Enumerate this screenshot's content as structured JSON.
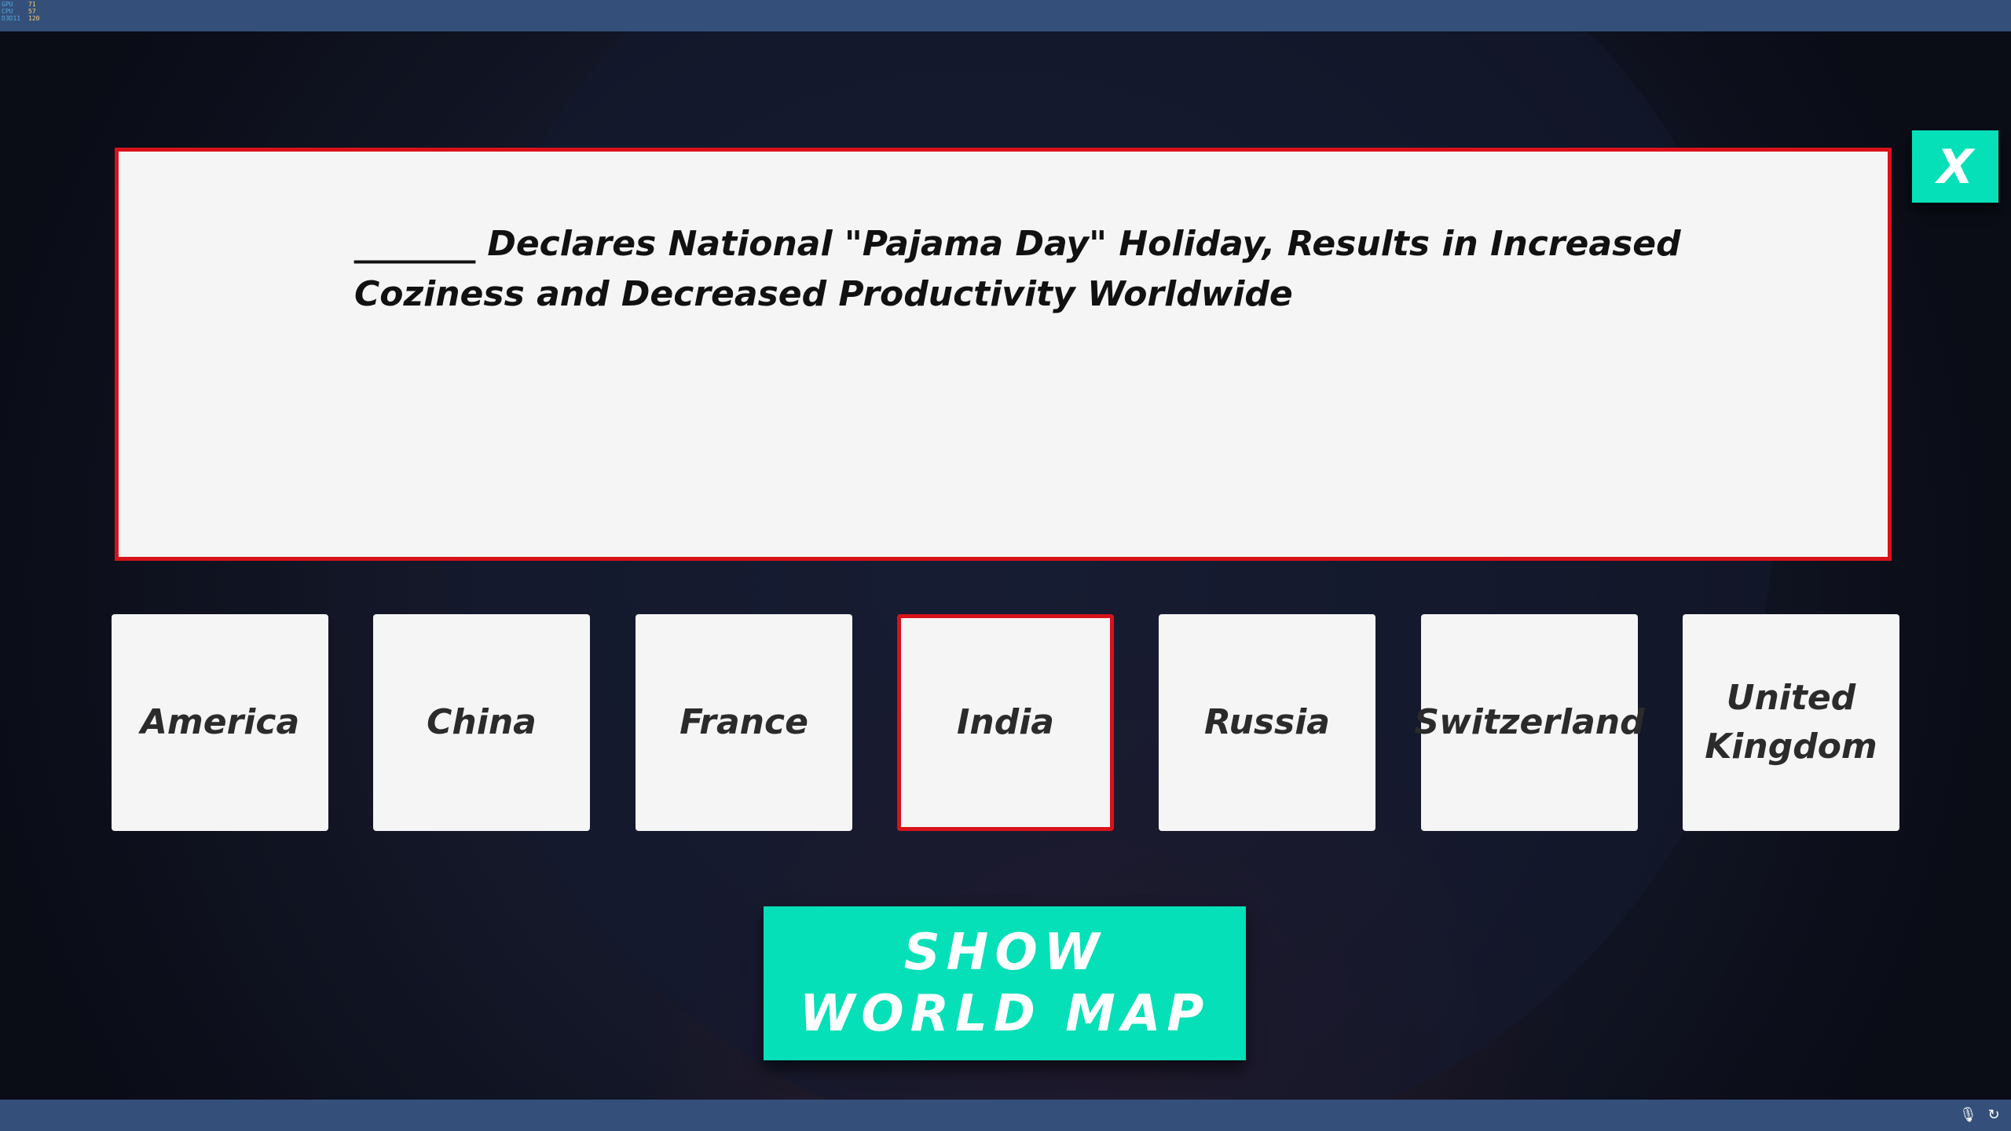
{
  "overlay": {
    "perf": [
      {
        "label": "GPU",
        "value": "71"
      },
      {
        "label": "CPU",
        "value": "57"
      },
      {
        "label": "D3D11",
        "value": "120"
      }
    ]
  },
  "question": {
    "headline": "_______ Declares National \"Pajama Day\" Holiday, Results in Increased Coziness and Decreased Productivity Worldwide"
  },
  "close_label": "X",
  "options": [
    {
      "label": "America",
      "selected": false
    },
    {
      "label": "China",
      "selected": false
    },
    {
      "label": "France",
      "selected": false
    },
    {
      "label": "India",
      "selected": true
    },
    {
      "label": "Russia",
      "selected": false
    },
    {
      "label": "Switzerland",
      "selected": false
    },
    {
      "label": "United Kingdom",
      "selected": false
    }
  ],
  "show_map_label": "SHOW WORLD MAP",
  "colors": {
    "accent": "#05e0b8",
    "selected_border": "#d8121a",
    "card_bg": "#f5f5f6",
    "taskbar": "#34507a"
  },
  "tray": {
    "icons": [
      "microphone-icon",
      "sync-icon"
    ]
  }
}
